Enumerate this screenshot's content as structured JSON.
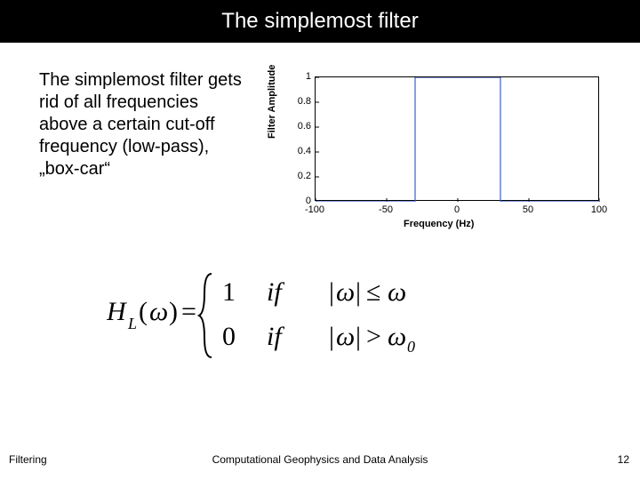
{
  "title": "The simplemost filter",
  "paragraph": "The simplemost filter gets rid of all frequencies above a certain cut-off frequency (low-pass), „box-car“",
  "chart_data": {
    "type": "line",
    "title": "",
    "xlabel": "Frequency (Hz)",
    "ylabel": "Filter Amplitude",
    "xlim": [
      -100,
      100
    ],
    "ylim": [
      0,
      1
    ],
    "xticks": [
      -100,
      -50,
      0,
      50,
      100
    ],
    "yticks": [
      0,
      0.2,
      0.4,
      0.6,
      0.8,
      1
    ],
    "series": [
      {
        "name": "boxcar",
        "x": [
          -100,
          -30,
          -30,
          30,
          30,
          100
        ],
        "y": [
          0,
          0,
          1,
          1,
          0,
          0
        ]
      }
    ]
  },
  "formula": {
    "lhs": "H",
    "lhs_sub": "L",
    "arg": "ω",
    "row1_val": "1",
    "row1_if": "if",
    "row1_cond_abs": "ω",
    "row1_cond_op": "≤",
    "row1_cond_rhs": "ω",
    "row2_val": "0",
    "row2_if": "if",
    "row2_cond_abs": "ω",
    "row2_cond_op": ">",
    "row2_cond_rhs": "ω",
    "row2_cond_rhs_sub": "0"
  },
  "footer": {
    "left": "Filtering",
    "center": "Computational Geophysics and Data Analysis",
    "right": "12"
  }
}
